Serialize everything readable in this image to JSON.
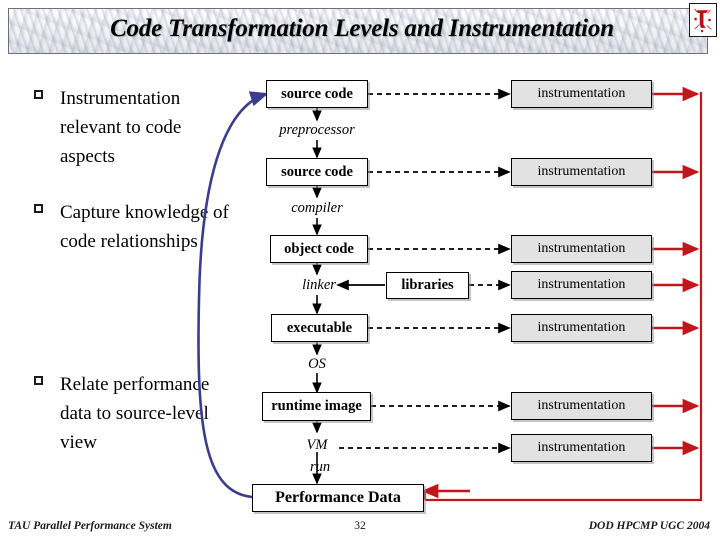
{
  "slide": {
    "title": "Code Transformation Levels and Instrumentation",
    "logo_name": "tau-logo"
  },
  "bullets": [
    {
      "id": "bullet-instrumentation-relevant",
      "text": "Instrumentation relevant to code aspects"
    },
    {
      "id": "bullet-capture-knowledge",
      "text": "Capture knowledge of code relationships"
    },
    {
      "id": "bullet-relate-performance",
      "text": "Relate performance data to source-level view"
    }
  ],
  "diagram": {
    "stages": [
      {
        "id": "stage-source-code-1",
        "label": "source code"
      },
      {
        "id": "stage-source-code-2",
        "label": "source code"
      },
      {
        "id": "stage-object-code",
        "label": "object code"
      },
      {
        "id": "stage-executable",
        "label": "executable"
      },
      {
        "id": "stage-runtime-image",
        "label": "runtime image"
      },
      {
        "id": "stage-performance-data",
        "label": "Performance Data"
      }
    ],
    "transforms": [
      {
        "id": "transform-preprocessor",
        "label": "preprocessor"
      },
      {
        "id": "transform-compiler",
        "label": "compiler"
      },
      {
        "id": "transform-linker",
        "label": "linker"
      },
      {
        "id": "transform-os",
        "label": "OS"
      },
      {
        "id": "transform-vm",
        "label": "VM"
      },
      {
        "id": "transform-run",
        "label": "run"
      }
    ],
    "libraries": {
      "id": "box-libraries",
      "label": "libraries"
    },
    "instrumentation": [
      {
        "id": "instrumentation-source-1",
        "label": "instrumentation"
      },
      {
        "id": "instrumentation-source-2",
        "label": "instrumentation"
      },
      {
        "id": "instrumentation-object",
        "label": "instrumentation"
      },
      {
        "id": "instrumentation-libraries",
        "label": "instrumentation"
      },
      {
        "id": "instrumentation-executable",
        "label": "instrumentation"
      },
      {
        "id": "instrumentation-runtime",
        "label": "instrumentation"
      },
      {
        "id": "instrumentation-vm",
        "label": "instrumentation"
      }
    ]
  },
  "colors": {
    "red_flow": "#c0161c",
    "blue_feedback": "#3c3c8c",
    "box_border": "#000000",
    "instrumentation_fill": "#e2e2e2"
  },
  "footer": {
    "left": "TAU Parallel Performance System",
    "page": "32",
    "right": "DOD HPCMP UGC 2004"
  }
}
